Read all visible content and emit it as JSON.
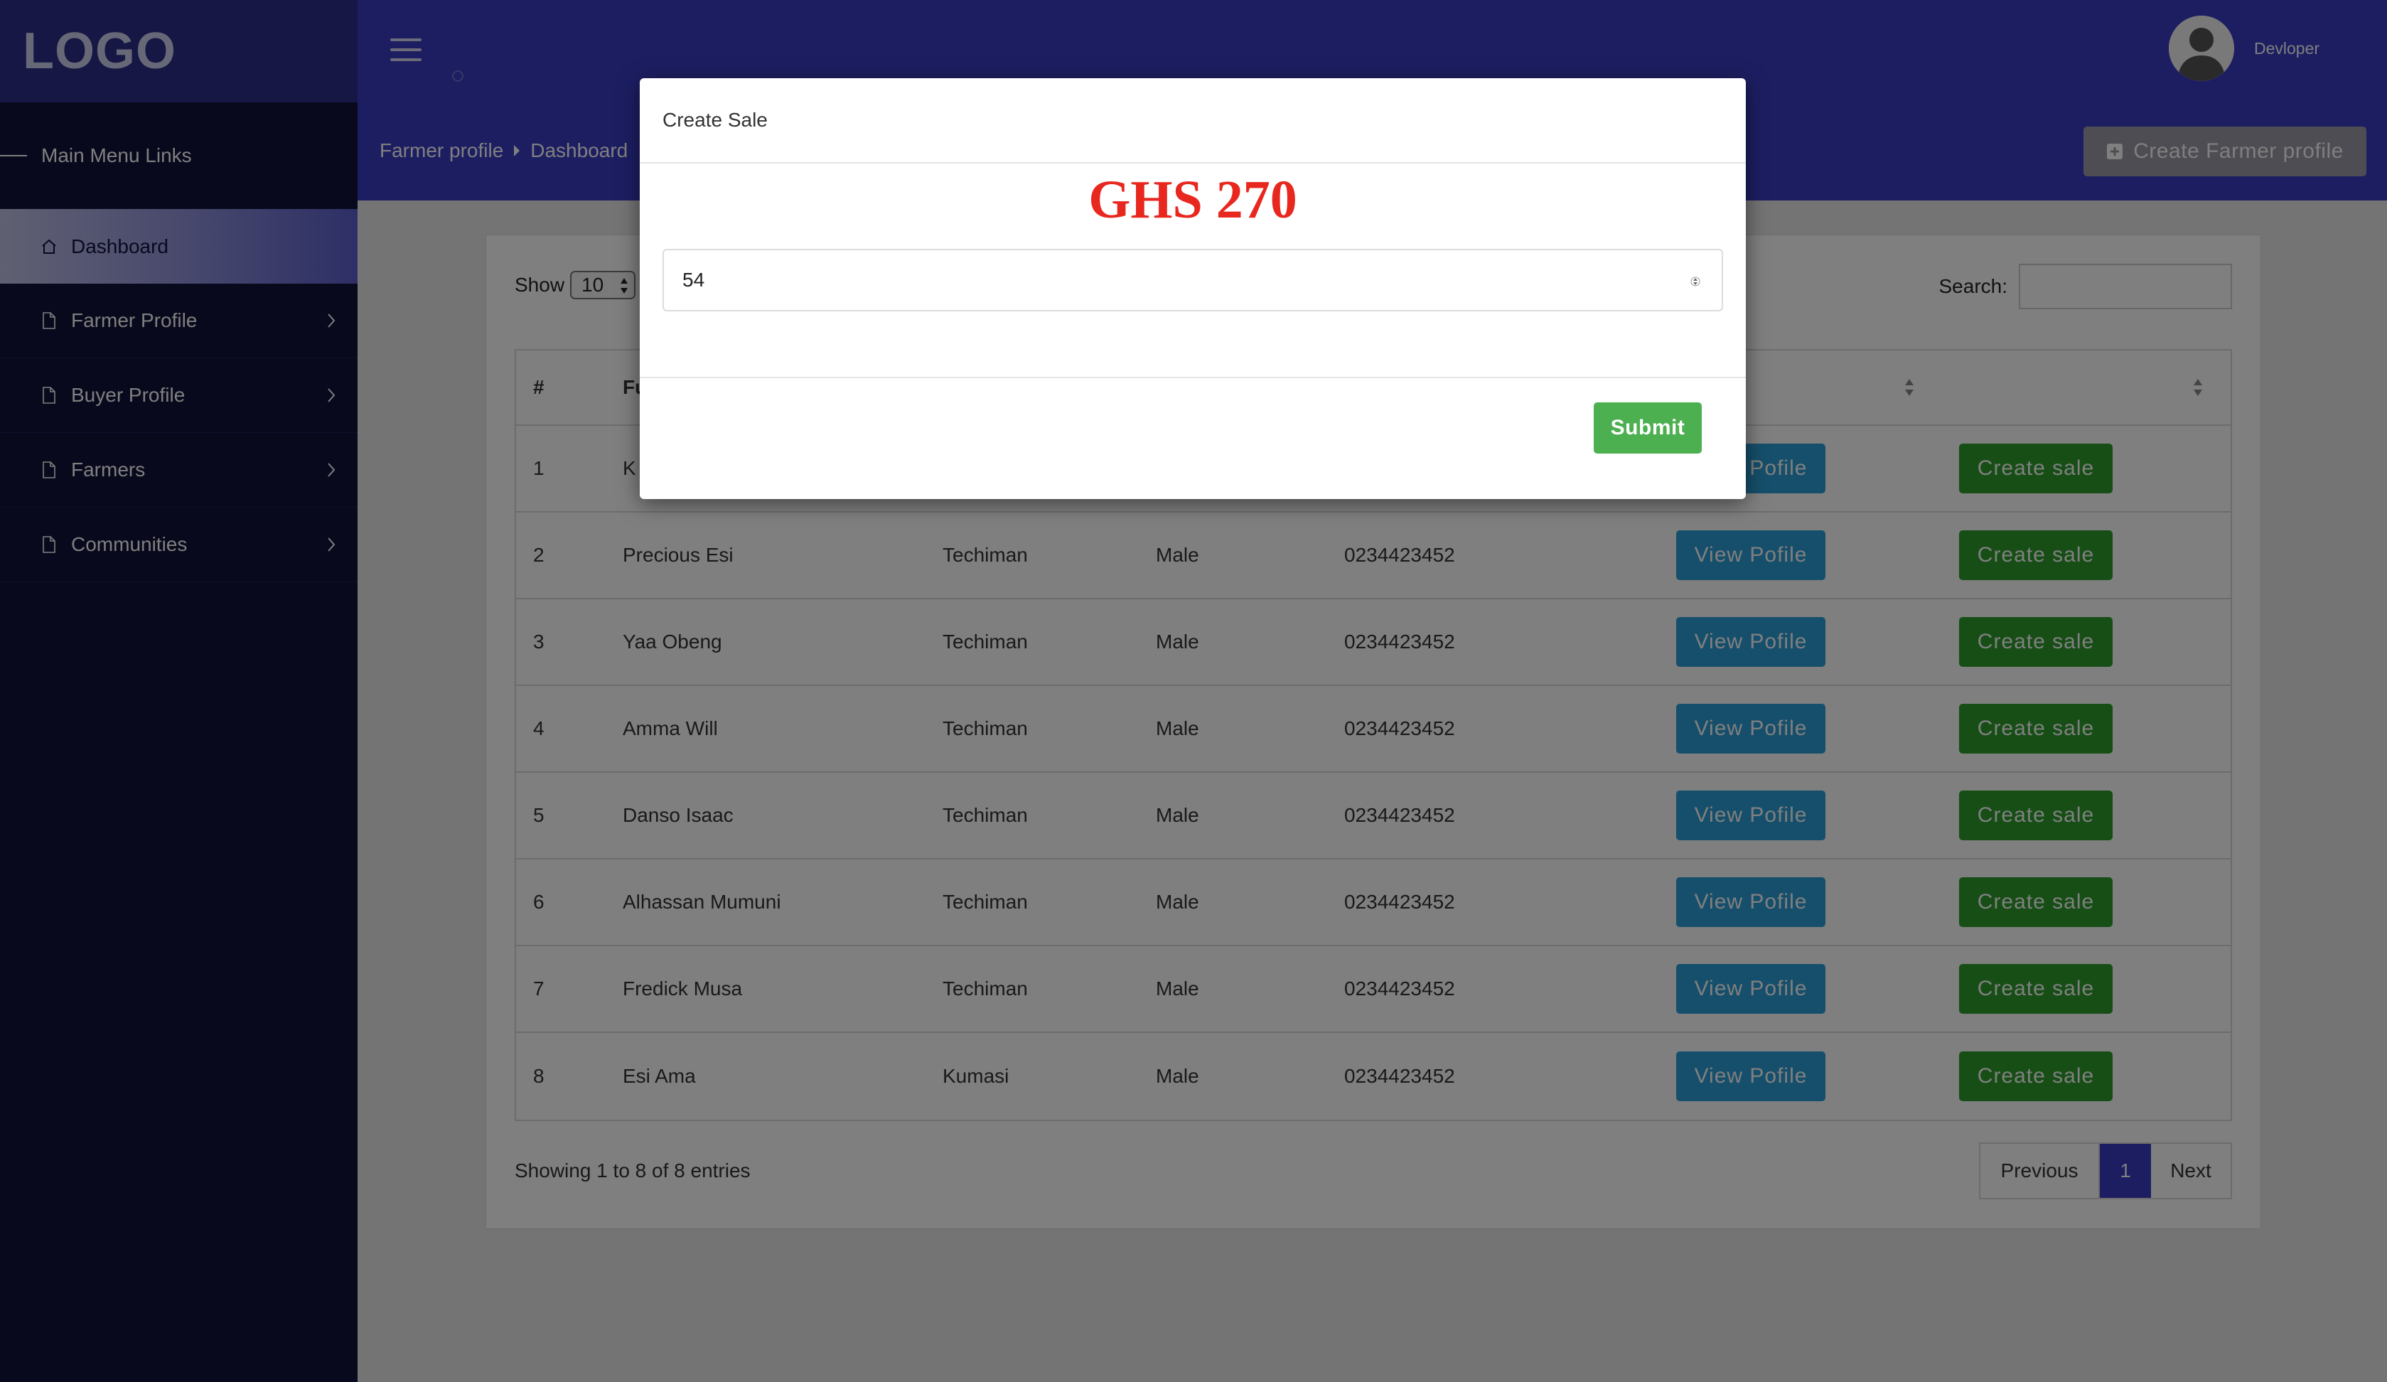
{
  "brand": {
    "logo_text": "LOGO"
  },
  "sidebar": {
    "heading": "Main Menu Links",
    "items": [
      {
        "label": "Dashboard",
        "icon": "home-icon",
        "active": true
      },
      {
        "label": "Farmer Profile",
        "icon": "file-icon",
        "has_submenu": true
      },
      {
        "label": "Buyer Profile",
        "icon": "file-icon",
        "has_submenu": true
      },
      {
        "label": "Farmers",
        "icon": "file-icon",
        "has_submenu": true
      },
      {
        "label": "Communities",
        "icon": "file-icon",
        "has_submenu": true
      }
    ]
  },
  "header": {
    "breadcrumb": [
      "Farmer profile",
      "Dashboard"
    ],
    "username": "Devloper",
    "create_button": "Create Farmer profile"
  },
  "table_controls": {
    "show_label": "Show",
    "page_size": "10",
    "search_label": "Search:"
  },
  "table": {
    "headers": {
      "num": "#",
      "name": "Fu"
    },
    "rows": [
      {
        "num": "1",
        "name": "K",
        "location": "",
        "gender": "",
        "phone": "",
        "view": "View Pofile",
        "sale": "Create sale"
      },
      {
        "num": "2",
        "name": "Precious Esi",
        "location": "Techiman",
        "gender": "Male",
        "phone": "0234423452",
        "view": "View Pofile",
        "sale": "Create sale"
      },
      {
        "num": "3",
        "name": "Yaa Obeng",
        "location": "Techiman",
        "gender": "Male",
        "phone": "0234423452",
        "view": "View Pofile",
        "sale": "Create sale"
      },
      {
        "num": "4",
        "name": "Amma Will",
        "location": "Techiman",
        "gender": "Male",
        "phone": "0234423452",
        "view": "View Pofile",
        "sale": "Create sale"
      },
      {
        "num": "5",
        "name": "Danso Isaac",
        "location": "Techiman",
        "gender": "Male",
        "phone": "0234423452",
        "view": "View Pofile",
        "sale": "Create sale"
      },
      {
        "num": "6",
        "name": "Alhassan Mumuni",
        "location": "Techiman",
        "gender": "Male",
        "phone": "0234423452",
        "view": "View Pofile",
        "sale": "Create sale"
      },
      {
        "num": "7",
        "name": "Fredick Musa",
        "location": "Techiman",
        "gender": "Male",
        "phone": "0234423452",
        "view": "View Pofile",
        "sale": "Create sale"
      },
      {
        "num": "8",
        "name": "Esi Ama",
        "location": "Kumasi",
        "gender": "Male",
        "phone": "0234423452",
        "view": "View Pofile",
        "sale": "Create sale"
      }
    ],
    "info": "Showing 1 to 8 of 8 entries"
  },
  "pagination": {
    "previous": "Previous",
    "current": "1",
    "next": "Next"
  },
  "modal": {
    "title": "Create Sale",
    "amount": "GHS 270",
    "quantity_value": "54",
    "submit_label": "Submit"
  },
  "colors": {
    "sidebar_bg": "#11123a",
    "header_bg": "#3a3cc4",
    "view_button": "#2d9ed6",
    "sale_button": "#2e9c2c",
    "submit_button": "#4caf50",
    "amount_text": "#e8281f"
  }
}
